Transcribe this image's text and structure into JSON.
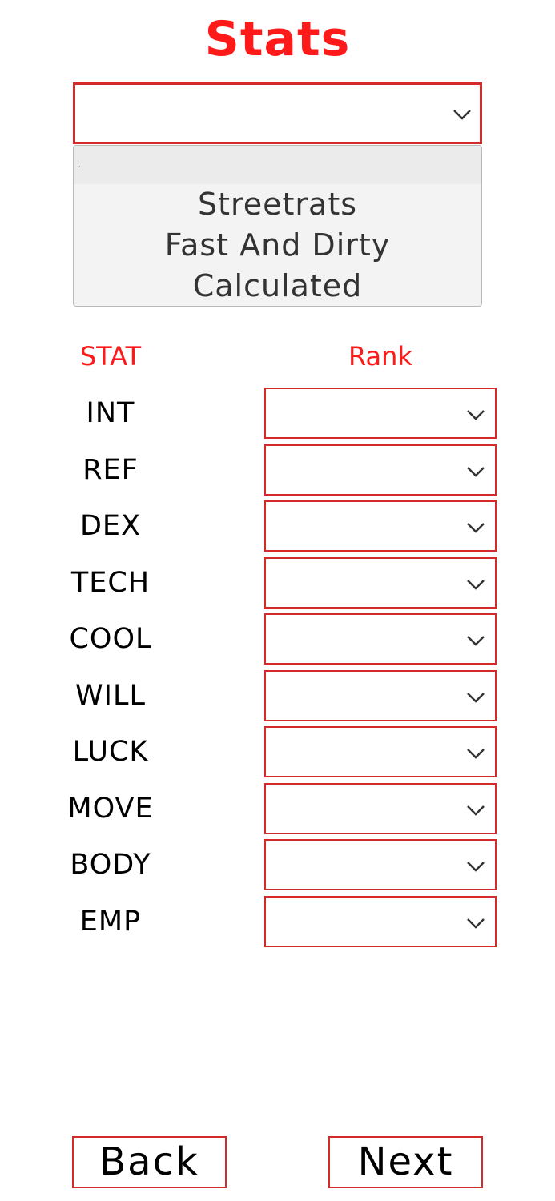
{
  "page": {
    "title": "Stats"
  },
  "method_select": {
    "value": "",
    "options": [
      "Streetrats",
      "Fast And Dirty",
      "Calculated"
    ]
  },
  "columns": {
    "stat": "STAT",
    "rank": "Rank"
  },
  "stats": [
    {
      "label": "INT",
      "rank": ""
    },
    {
      "label": "REF",
      "rank": ""
    },
    {
      "label": "DEX",
      "rank": ""
    },
    {
      "label": "TECH",
      "rank": ""
    },
    {
      "label": "COOL",
      "rank": ""
    },
    {
      "label": "WILL",
      "rank": ""
    },
    {
      "label": "LUCK",
      "rank": ""
    },
    {
      "label": "MOVE",
      "rank": ""
    },
    {
      "label": "BODY",
      "rank": ""
    },
    {
      "label": "EMP",
      "rank": ""
    }
  ],
  "nav": {
    "back_label": "Back",
    "next_label": "Next"
  },
  "colors": {
    "accent": "#ff1a1a",
    "border": "#d42a2a",
    "list_bg": "#f3f3f3",
    "text": "#000000"
  },
  "icons": {
    "select_arrow": "chevron-down-icon"
  }
}
